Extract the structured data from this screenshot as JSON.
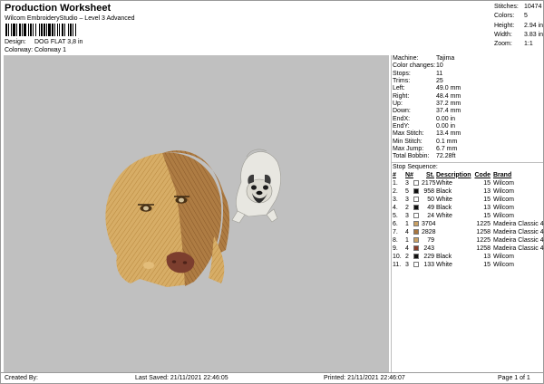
{
  "header": {
    "title": "Production Worksheet",
    "subtitle": "Wilcom EmbroideryStudio – Level 3 Advanced",
    "design_label": "Design:",
    "design_value": "DOG FLAT 3,8 in",
    "colorway_label": "Colorway:",
    "colorway_value": "Colorway 1"
  },
  "stats": [
    {
      "label": "Stitches:",
      "value": "10474"
    },
    {
      "label": "Colors:",
      "value": "5"
    },
    {
      "label": "Height:",
      "value": "2.94 in"
    },
    {
      "label": "Width:",
      "value": "3.83 in"
    },
    {
      "label": "Zoom:",
      "value": "1:1"
    }
  ],
  "properties": [
    {
      "label": "Machine:",
      "value": "Tajima"
    },
    {
      "label": "Color changes:",
      "value": "10"
    },
    {
      "label": "Stops:",
      "value": "11"
    },
    {
      "label": "Trims:",
      "value": "25"
    },
    {
      "label": "Left:",
      "value": "49.0 mm"
    },
    {
      "label": "Right:",
      "value": "48.4 mm"
    },
    {
      "label": "Up:",
      "value": "37.2 mm"
    },
    {
      "label": "Down:",
      "value": "37.4 mm"
    },
    {
      "label": "EndX:",
      "value": "0.00 in"
    },
    {
      "label": "EndY:",
      "value": "0.00 in"
    },
    {
      "label": "Max Stitch:",
      "value": "13.4 mm"
    },
    {
      "label": "Min Stitch:",
      "value": "0.1 mm"
    },
    {
      "label": "Max Jump:",
      "value": "6.7 mm"
    },
    {
      "label": "Total Bobbin:",
      "value": "72.28ft"
    }
  ],
  "stop_sequence": {
    "title": "Stop Sequence:",
    "headers": [
      "#",
      "N#",
      "St.",
      "Description",
      "Code",
      "Brand"
    ],
    "rows": [
      {
        "num": "1.",
        "n": "3",
        "color": "#ffffff",
        "st": "2175",
        "desc": "White",
        "code": "15",
        "brand": "Wilcom"
      },
      {
        "num": "2.",
        "n": "5",
        "color": "#111111",
        "st": "958",
        "desc": "Black",
        "code": "13",
        "brand": "Wilcom"
      },
      {
        "num": "3.",
        "n": "3",
        "color": "#ffffff",
        "st": "50",
        "desc": "White",
        "code": "15",
        "brand": "Wilcom"
      },
      {
        "num": "4.",
        "n": "2",
        "color": "#111111",
        "st": "49",
        "desc": "Black",
        "code": "13",
        "brand": "Wilcom"
      },
      {
        "num": "5.",
        "n": "3",
        "color": "#ffffff",
        "st": "24",
        "desc": "White",
        "code": "15",
        "brand": "Wilcom"
      },
      {
        "num": "6.",
        "n": "1",
        "color": "#c9a063",
        "st": "3704",
        "desc": "",
        "code": "1225",
        "brand": "Madeira Classic 40"
      },
      {
        "num": "7.",
        "n": "4",
        "color": "#a8763f",
        "st": "2828",
        "desc": "",
        "code": "1258",
        "brand": "Madeira Classic 40"
      },
      {
        "num": "8.",
        "n": "1",
        "color": "#c9a063",
        "st": "79",
        "desc": "",
        "code": "1225",
        "brand": "Madeira Classic 40"
      },
      {
        "num": "9.",
        "n": "4",
        "color": "#8a3e2a",
        "st": "243",
        "desc": "",
        "code": "1258",
        "brand": "Madeira Classic 40"
      },
      {
        "num": "10.",
        "n": "2",
        "color": "#111111",
        "st": "229",
        "desc": "Black",
        "code": "13",
        "brand": "Wilcom"
      },
      {
        "num": "11.",
        "n": "3",
        "color": "#ffffff",
        "st": "133",
        "desc": "White",
        "code": "15",
        "brand": "Wilcom"
      }
    ]
  },
  "footer": {
    "created_by": "Created By:",
    "last_saved": "Last Saved: 21/11/2021 22:46:05",
    "printed": "Printed: 21/11/2021 22:46:07",
    "page": "Page 1 of 1"
  },
  "colors": {
    "canvas_bg": "#c0c0c0",
    "dog_fur_light": "#d4a960",
    "dog_fur_dark": "#a9793f",
    "dog_nose": "#7c3e2e"
  }
}
